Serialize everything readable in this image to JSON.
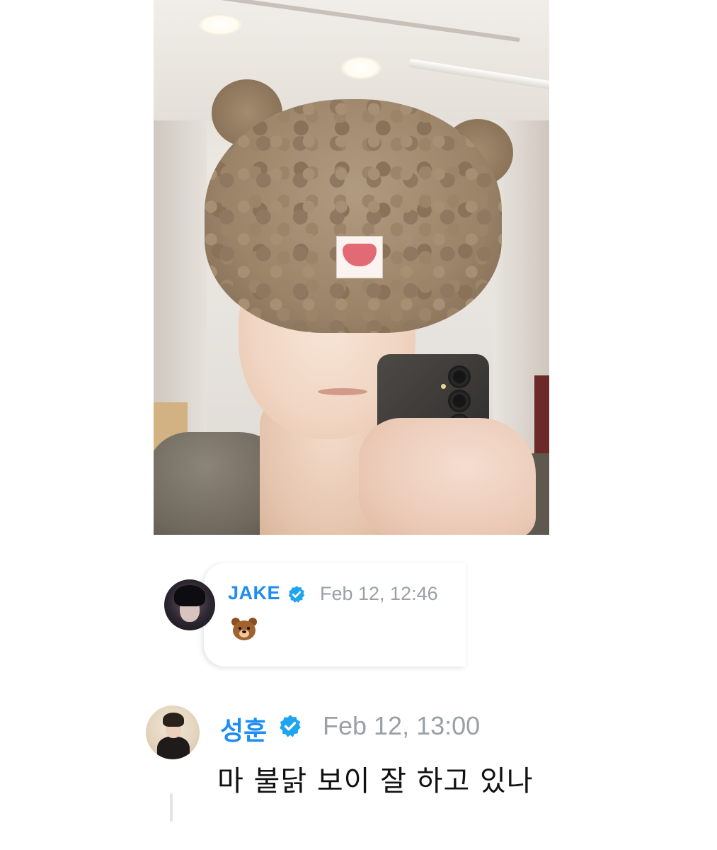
{
  "post": {
    "photo_subject": "selfie-photo"
  },
  "comments": [
    {
      "author": "JAKE",
      "verified": true,
      "timestamp": "Feb 12, 12:46",
      "text": "🐻",
      "icon": "bear-emoji-icon"
    },
    {
      "author": "성훈",
      "verified": true,
      "timestamp": "Feb 12, 13:00",
      "text": "마 불닭 보이 잘 하고 있나"
    }
  ],
  "colors": {
    "name_blue": "#1d8df2",
    "badge_blue": "#1fa5f0",
    "timestamp_gray": "#9aa0a6",
    "background": "#ffffff"
  }
}
